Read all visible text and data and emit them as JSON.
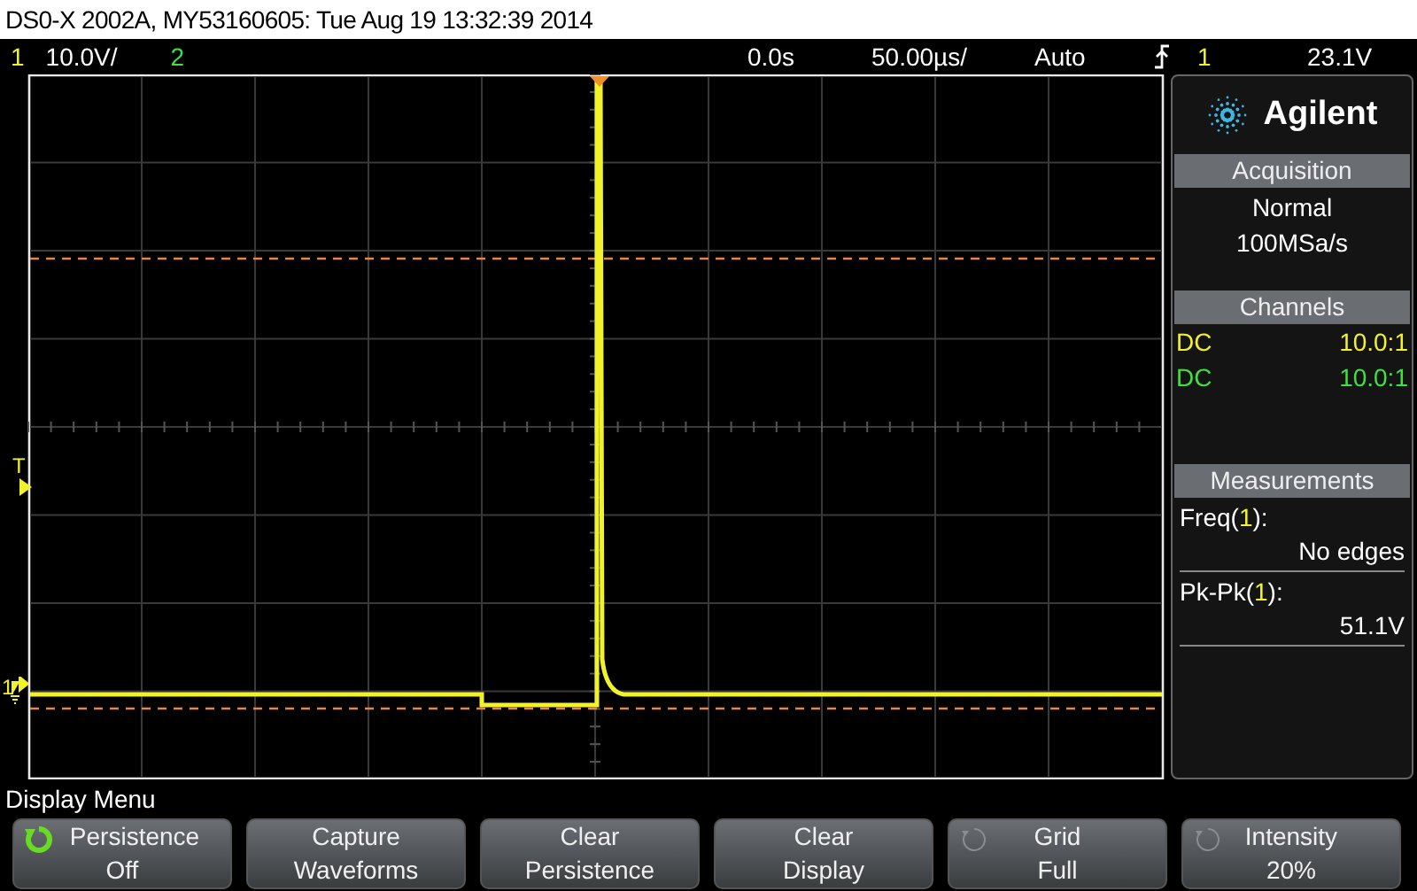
{
  "title_bar": {
    "text": "DS0-X 2002A, MY53160605: Tue Aug 19 13:32:39 2014"
  },
  "status_line": {
    "channels": [
      {
        "label": "1",
        "scale": "10.0V/",
        "color": "#f2f22a"
      },
      {
        "label": "2",
        "color": "#3fe03f"
      }
    ],
    "delay": "0.0s",
    "timebase": "50.00µs/",
    "mode": "Auto",
    "trigger_source": "1",
    "trigger_level": "23.1V"
  },
  "scope": {
    "trigger_marker": "T",
    "channel_marker": "1"
  },
  "side_panel": {
    "brand": "Agilent",
    "acquisition": {
      "header": "Acquisition",
      "mode": "Normal",
      "rate": "100MSa/s"
    },
    "channels": {
      "header": "Channels",
      "items": [
        {
          "coupling": "DC",
          "probe": "10.0:1",
          "color": "#f2f22a"
        },
        {
          "coupling": "DC",
          "probe": "10.0:1",
          "color": "#3fe03f"
        }
      ]
    },
    "measurements": {
      "header": "Measurements",
      "items": [
        {
          "prefix": "Freq(",
          "source": "1",
          "suffix": "):",
          "value": "No edges"
        },
        {
          "prefix": "Pk-Pk(",
          "source": "1",
          "suffix": "):",
          "value": "51.1V"
        }
      ]
    }
  },
  "menu": {
    "title": "Display Menu",
    "softkeys": [
      {
        "kind": "knob_active",
        "label": "Persistence",
        "value": "Off"
      },
      {
        "kind": "plain",
        "label": "Capture",
        "value": "Waveforms"
      },
      {
        "kind": "plain",
        "label": "Clear",
        "value": "Persistence"
      },
      {
        "kind": "plain",
        "label": "Clear",
        "value": "Display"
      },
      {
        "kind": "knob_inactive",
        "label": "Grid",
        "value": "Full"
      },
      {
        "kind": "knob_inactive",
        "label": "Intensity",
        "value": "20%"
      }
    ]
  }
}
